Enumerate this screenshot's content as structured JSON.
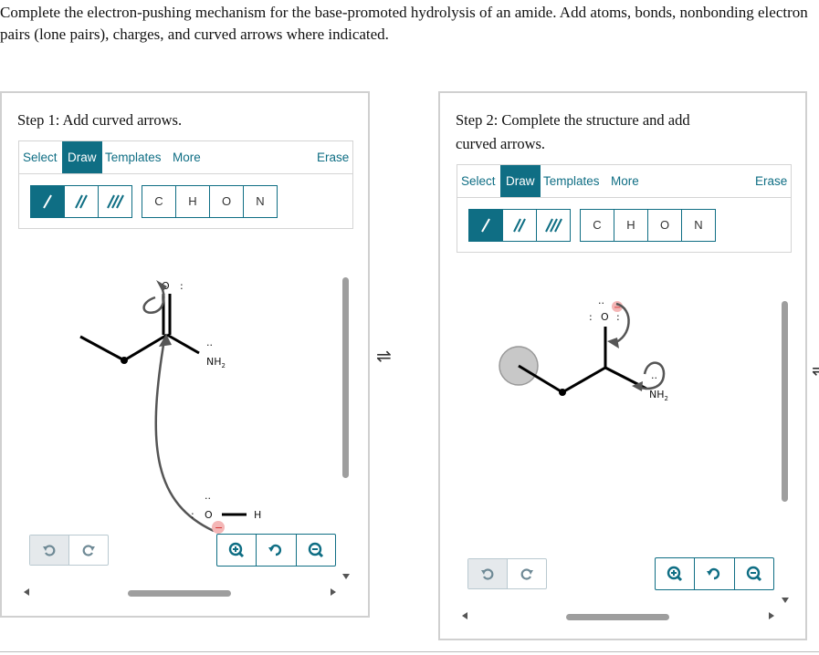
{
  "instructions": "Complete the electron-pushing mechanism for the base-promoted hydrolysis of an amide. Add atoms, bonds, nonbonding electron pairs (lone pairs), charges, and curved arrows where indicated.",
  "equilibrium_symbol": "⇌",
  "panel1": {
    "step_label": "Step 1: Add curved arrows.",
    "toolbar": {
      "select": "Select",
      "draw": "Draw",
      "templates": "Templates",
      "more": "More",
      "erase": "Erase"
    },
    "atoms": [
      "C",
      "H",
      "O",
      "N"
    ],
    "molecule": {
      "carbonyl_o": "O",
      "carbonyl_o_lone_pair": ":",
      "amine": "NH",
      "amine_sub": "2",
      "hydroxide_o": "O",
      "hydroxide_h": "H",
      "charge": "−"
    }
  },
  "panel2": {
    "step_label": "Step 2: Complete the structure and add curved arrows.",
    "toolbar": {
      "select": "Select",
      "draw": "Draw",
      "templates": "Templates",
      "more": "More",
      "erase": "Erase"
    },
    "atoms": [
      "C",
      "H",
      "O",
      "N"
    ],
    "molecule": {
      "oxygen": "O",
      "oxygen_left_pair": ":",
      "oxygen_right_pair": ":",
      "amine": "NH",
      "amine_sub": "2",
      "charge": "−"
    }
  },
  "colors": {
    "accent": "#0f6e84",
    "border": "#d0d0d0",
    "scroll": "#9e9e9e",
    "charge_highlight": "#f4b6b6",
    "selection_circle": "#c8c8c8"
  }
}
